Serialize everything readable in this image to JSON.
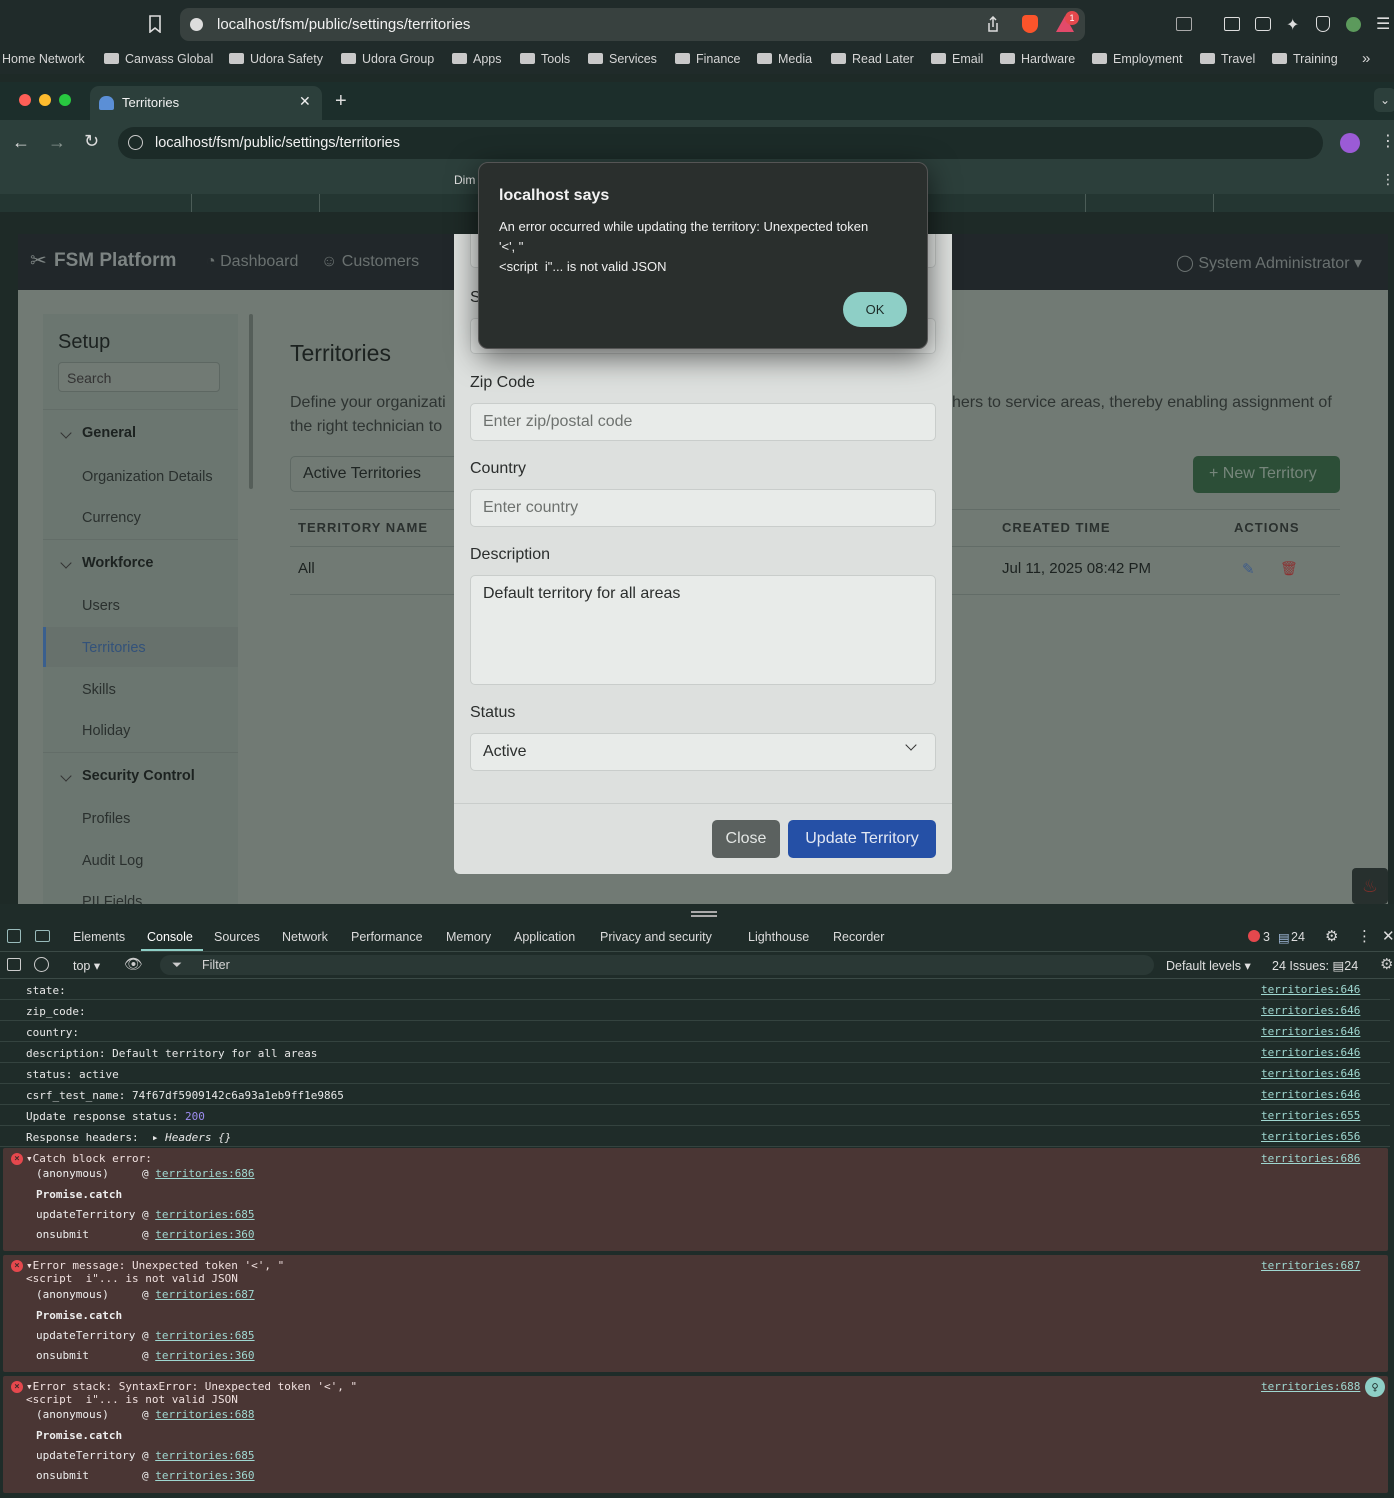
{
  "outer_browser": {
    "url": "localhost/fsm/public/settings/territories",
    "notification_count": "1"
  },
  "bookmarks": [
    "Home Network",
    "Canvass Global",
    "Udora Safety",
    "Udora Group",
    "Apps",
    "Tools",
    "Services",
    "Finance",
    "Media",
    "Read Later",
    "Email",
    "Hardware",
    "Employment",
    "Travel",
    "Training"
  ],
  "inner_browser": {
    "tab_title": "Territories",
    "url": "localhost/fsm/public/settings/territories",
    "devbar_text": "Dim"
  },
  "app": {
    "brand": "FSM Platform",
    "nav": [
      "Dashboard",
      "Customers"
    ],
    "user": "System Administrator",
    "sidebar": {
      "title": "Setup",
      "search_placeholder": "Search",
      "general": "General",
      "org": "Organization Details",
      "currency": "Currency",
      "workforce": "Workforce",
      "users": "Users",
      "territories": "Territories",
      "skills": "Skills",
      "holiday": "Holiday",
      "security": "Security Control",
      "profiles": "Profiles",
      "audit": "Audit Log",
      "pii": "PII Fields"
    },
    "page_title": "Territories",
    "desc_left_1": "Define your organizati",
    "desc_left_2": "the right technician to",
    "desc_right": "hers to service areas, thereby enabling assignment of",
    "filter_value": "Active Territories",
    "new_button": "+ New Territory",
    "table": {
      "col_name": "TERRITORY NAME",
      "col_created": "CREATED TIME",
      "col_actions": "ACTIONS",
      "row": {
        "name": "All",
        "created": "Jul 11, 2025 08:42 PM"
      }
    }
  },
  "modal": {
    "partial_label": "S",
    "zip_label": "Zip Code",
    "zip_placeholder": "Enter zip/postal code",
    "country_label": "Country",
    "country_placeholder": "Enter country",
    "description_label": "Description",
    "description_value": "Default territory for all areas",
    "status_label": "Status",
    "status_value": "Active",
    "close": "Close",
    "update": "Update Territory"
  },
  "alert": {
    "title": "localhost says",
    "line1": "An error occurred while updating the territory: Unexpected token",
    "line2": "'<', \"",
    "line3": "<script  i\"... is not valid JSON",
    "ok": "OK"
  },
  "devtools": {
    "tabs": [
      "Elements",
      "Console",
      "Sources",
      "Network",
      "Performance",
      "Memory",
      "Application",
      "Privacy and security",
      "Lighthouse",
      "Recorder"
    ],
    "errors": "3",
    "messages": "24",
    "context": "top",
    "filter_placeholder": "Filter",
    "levels": "Default levels",
    "issues_label": "24 Issues:",
    "issues_count": "24",
    "logs": [
      {
        "text": "state:",
        "src": "territories:646"
      },
      {
        "text": "zip_code:",
        "src": "territories:646"
      },
      {
        "text": "country:",
        "src": "territories:646"
      },
      {
        "text": "description: Default territory for all areas",
        "src": "territories:646"
      },
      {
        "text": "status: active",
        "src": "territories:646"
      },
      {
        "text": "csrf_test_name: 74f67df5909142c6a93a1eb9ff1e9865",
        "src": "territories:646"
      },
      {
        "text": "Update response status: ",
        "num": "200",
        "src": "territories:655"
      },
      {
        "text": "Response headers:",
        "obj": "Headers {}",
        "src": "territories:656"
      }
    ],
    "error_blocks": [
      {
        "l1": "Catch block error:",
        "l2": "",
        "src": "territories:686",
        "frames": [
          [
            "(anonymous)",
            "territories:686"
          ],
          [
            "Promise.catch",
            ""
          ],
          [
            "updateTerritory",
            "territories:685"
          ],
          [
            "onsubmit",
            "territories:360"
          ]
        ]
      },
      {
        "l1": "Error message: Unexpected token '<', \"",
        "l2": "<script  i\"... is not valid JSON",
        "src": "territories:687",
        "frames": [
          [
            "(anonymous)",
            "territories:687"
          ],
          [
            "Promise.catch",
            ""
          ],
          [
            "updateTerritory",
            "territories:685"
          ],
          [
            "onsubmit",
            "territories:360"
          ]
        ]
      },
      {
        "l1": "Error stack: SyntaxError: Unexpected token '<', \"",
        "l2": "<script  i\"... is not valid JSON",
        "src": "territories:688",
        "frames": [
          [
            "(anonymous)",
            "territories:688"
          ],
          [
            "Promise.catch",
            ""
          ],
          [
            "updateTerritory",
            "territories:685"
          ],
          [
            "onsubmit",
            "territories:360"
          ]
        ]
      }
    ]
  }
}
